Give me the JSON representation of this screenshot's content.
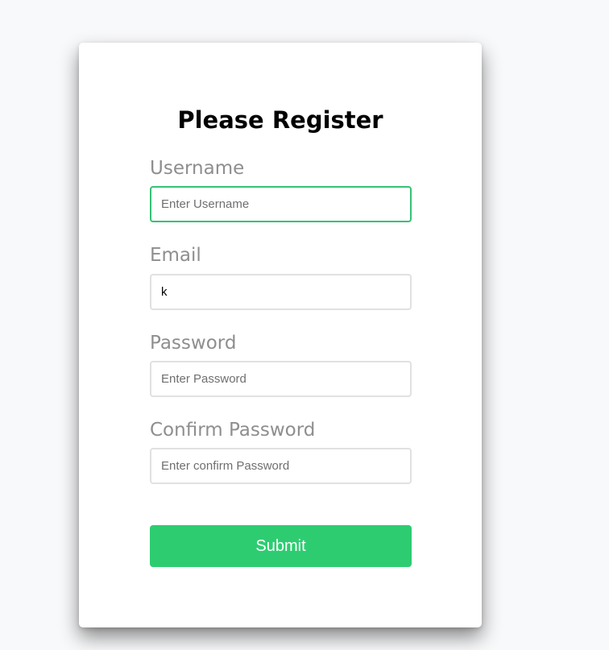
{
  "form": {
    "title": "Please Register",
    "fields": [
      {
        "label": "Username",
        "placeholder": "Enter Username",
        "value": "",
        "focused": true
      },
      {
        "label": "Email",
        "placeholder": "",
        "value": "k",
        "focused": false
      },
      {
        "label": "Password",
        "placeholder": "Enter Password",
        "value": "",
        "focused": false
      },
      {
        "label": "Confirm Password",
        "placeholder": "Enter confirm Password",
        "value": "",
        "focused": false
      }
    ],
    "submit_label": "Submit"
  },
  "colors": {
    "accent": "#2ecc71",
    "focus_border": "#35c274",
    "label": "#8e8e8e",
    "background": "#f8f9fa",
    "card": "#ffffff"
  }
}
